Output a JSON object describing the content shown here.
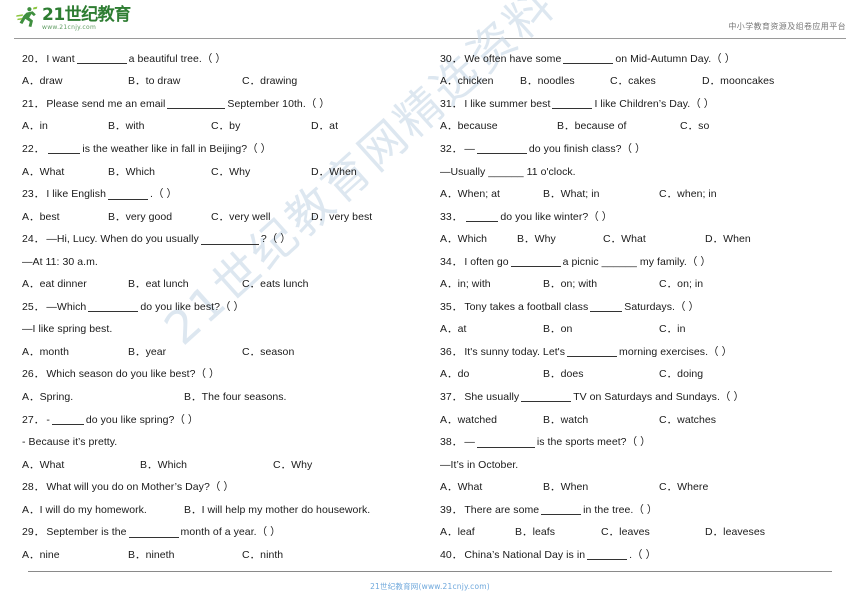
{
  "header": {
    "logo_main": "21世纪教育",
    "logo_sub": "www.21cnjy.com",
    "logo_icon": "running-person-icon",
    "right_text": "中小学教育资源及组卷应用平台"
  },
  "watermark": {
    "text": "21世纪教育网精选资料",
    "color": "#c9d9e8"
  },
  "footer": {
    "text": "21世纪教育网(www.21cnjy.com)",
    "color": "#6fa8dc"
  },
  "left_column": [
    {
      "kind": "stem",
      "num": "20．",
      "pre": "I want ",
      "blank": "b-l",
      "post": "a beautiful tree.（      ）"
    },
    {
      "kind": "opts3",
      "widths": "opt",
      "a": "A．draw",
      "b": "B．to draw",
      "c": "C．drawing"
    },
    {
      "kind": "stem",
      "num": "21．",
      "pre": "Please send me an email ",
      "blank": "b-xl",
      "post": "September 10th.（      ）"
    },
    {
      "kind": "opts4",
      "widths": "w4",
      "a": "A．in",
      "b": "B．with",
      "c": "C．by",
      "d": "D．at"
    },
    {
      "kind": "stem",
      "num": "22．",
      "pre": "",
      "blank": "b-s",
      "post": "is the weather like in fall in Beijing?（    ）"
    },
    {
      "kind": "opts4",
      "widths": "w4",
      "a": "A．What",
      "b": "B．Which",
      "c": "C．Why",
      "d": "D．When"
    },
    {
      "kind": "stem",
      "num": "23．",
      "pre": "I like English ",
      "blank": "b-m",
      "post": ".（    ）"
    },
    {
      "kind": "opts4",
      "widths": "w4",
      "a": "A．best",
      "b": "B．very good",
      "c": "C．very well",
      "d": "D．very best"
    },
    {
      "kind": "stem",
      "num": "24．",
      "pre": "—Hi, Lucy. When do you usually ",
      "blank": "b-xl",
      "post": "?（      ）"
    },
    {
      "kind": "cont",
      "text": "—At 11: 30 a.m."
    },
    {
      "kind": "opts3",
      "widths": "opt",
      "a": "A．eat dinner",
      "b": "B．eat lunch",
      "c": "C．eats lunch"
    },
    {
      "kind": "stem",
      "num": "25．",
      "pre": "—Which ",
      "blank": "b-l",
      "post": "do you like best?（      ）"
    },
    {
      "kind": "cont",
      "text": "—I like spring best."
    },
    {
      "kind": "opts3",
      "widths": "opt",
      "a": "A．month",
      "b": "B．year",
      "c": "C．season"
    },
    {
      "kind": "stem",
      "num": "26．",
      "pre": "Which season do you like best?（      ）",
      "blank": "",
      "post": ""
    },
    {
      "kind": "opts2",
      "widths": "w2",
      "a": "A．Spring.",
      "b": "B．The four seasons."
    },
    {
      "kind": "stem",
      "num": "27．",
      "pre": "- ",
      "blank": "b-s",
      "post": "do you like spring?（    ）"
    },
    {
      "kind": "cont",
      "text": "- Because it’s pretty."
    },
    {
      "kind": "opts3",
      "widths": "w3",
      "a": "A．What",
      "b": "B．Which",
      "c": "C．Why"
    },
    {
      "kind": "stem",
      "num": "28．",
      "pre": "What will you do on Mother’s Day?（    ）",
      "blank": "",
      "post": ""
    },
    {
      "kind": "opts2",
      "widths": "w2",
      "a": "A．I will do my homework.",
      "b": "B．I will help my mother do housework."
    },
    {
      "kind": "stem",
      "num": "29．",
      "pre": "September is the ",
      "blank": "b-l",
      "post": "month of a year.（      ）"
    },
    {
      "kind": "opts3",
      "widths": "opt",
      "a": "A．nine",
      "b": "B．nineth",
      "c": "C．ninth"
    }
  ],
  "right_column": [
    {
      "kind": "stem",
      "num": "30．",
      "pre": "We often have some ",
      "blank": "b-l",
      "post": "on Mid-Autumn Day.（      ）"
    },
    {
      "kind": "opts4",
      "widths": "w4",
      "a": "A．chicken",
      "b": "B．noodles",
      "c": "C．cakes",
      "d": "D．mooncakes"
    },
    {
      "kind": "stem",
      "num": "31．",
      "pre": "I like summer best ",
      "blank": "b-m",
      "post": "I like Children’s Day.（      ）"
    },
    {
      "kind": "opts3",
      "widths": "w3",
      "a": "A．because",
      "b": "B．because of",
      "c": "C．so"
    },
    {
      "kind": "stem",
      "num": "32．",
      "pre": "—",
      "blank": "b-l",
      "post": "do you finish class?（      ）"
    },
    {
      "kind": "cont",
      "text": "—Usually ______ 11 o'clock."
    },
    {
      "kind": "opts3",
      "widths": "opt",
      "a": "A．When; at",
      "b": "B．What; in",
      "c": "C．when; in"
    },
    {
      "kind": "stem",
      "num": "33．",
      "pre": "",
      "blank": "b-s",
      "post": "do you like winter?（    ）"
    },
    {
      "kind": "opts4",
      "widths": "w4b",
      "a": "A．Which",
      "b": "B．Why",
      "c": "C．What",
      "d": "D．When"
    },
    {
      "kind": "stem",
      "num": "34．",
      "pre": "I often go ",
      "blank": "b-l",
      "post": "a picnic ______ my family.（      ）"
    },
    {
      "kind": "opts3",
      "widths": "opt",
      "a": "A．in; with",
      "b": "B．on; with",
      "c": "C．on; in"
    },
    {
      "kind": "stem",
      "num": "35．",
      "pre": "Tony takes a football class ",
      "blank": "b-s",
      "post": "Saturdays.（      ）"
    },
    {
      "kind": "opts3",
      "widths": "opt",
      "a": "A．at",
      "b": "B．on",
      "c": "C．in"
    },
    {
      "kind": "stem",
      "num": "36．",
      "pre": "It's sunny today. Let's ",
      "blank": "b-l",
      "post": "morning exercises.（      ）"
    },
    {
      "kind": "opts3",
      "widths": "opt",
      "a": "A．do",
      "b": "B．does",
      "c": "C．doing"
    },
    {
      "kind": "stem",
      "num": "37．",
      "pre": "She usually ",
      "blank": "b-l",
      "post": "TV on Saturdays and Sundays.（      ）"
    },
    {
      "kind": "opts3",
      "widths": "opt",
      "a": "A．watched",
      "b": "B．watch",
      "c": "C．watches"
    },
    {
      "kind": "stem",
      "num": "38．",
      "pre": "—",
      "blank": "b-xl",
      "post": "is the sports meet?（      ）"
    },
    {
      "kind": "cont",
      "text": "—It’s in October."
    },
    {
      "kind": "opts3",
      "widths": "opt",
      "a": "A．What",
      "b": "B．When",
      "c": "C．Where"
    },
    {
      "kind": "stem",
      "num": "39．",
      "pre": "There are some ",
      "blank": "b-m",
      "post": "in the tree.（    ）"
    },
    {
      "kind": "opts4",
      "widths": "w4c",
      "a": "A．leaf",
      "b": "B．leafs",
      "c": "C．leaves",
      "d": "D．leaveses"
    },
    {
      "kind": "stem",
      "num": "40．",
      "pre": "China’s National Day is in ",
      "blank": "b-m",
      "post": ".（      ）"
    }
  ]
}
